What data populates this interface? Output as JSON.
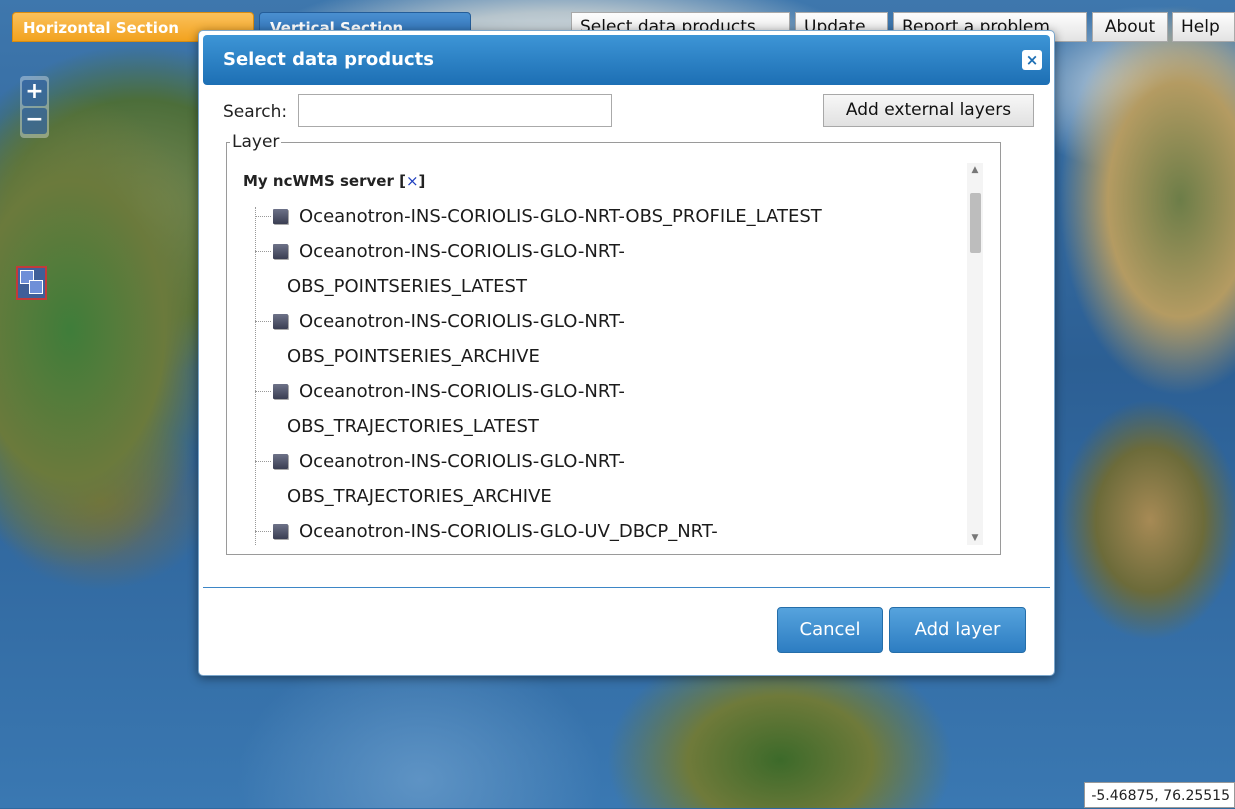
{
  "toolbar": {
    "tab_horizontal": "Horizontal Section",
    "tab_vertical": "Vertical Section",
    "select_data_products": "Select data products",
    "update": "Update",
    "report_problem": "Report a problem",
    "about": "About",
    "help": "Help"
  },
  "map": {
    "zoom_in": "+",
    "zoom_out": "−",
    "coordinates": "-5.46875, 76.25515"
  },
  "dialog": {
    "title": "Select data products",
    "close": "×",
    "search_label": "Search:",
    "search_value": "",
    "add_external_layers": "Add external layers",
    "fieldset_legend": "Layer",
    "server": {
      "name": "My ncWMS server",
      "remove_open": "[",
      "remove_x": "×",
      "remove_close": "]"
    },
    "layers": [
      {
        "line1": "Oceanotron-INS-CORIOLIS-GLO-NRT-OBS_PROFILE_LATEST",
        "line2": ""
      },
      {
        "line1": "Oceanotron-INS-CORIOLIS-GLO-NRT-",
        "line2": "OBS_POINTSERIES_LATEST"
      },
      {
        "line1": "Oceanotron-INS-CORIOLIS-GLO-NRT-",
        "line2": "OBS_POINTSERIES_ARCHIVE"
      },
      {
        "line1": "Oceanotron-INS-CORIOLIS-GLO-NRT-",
        "line2": "OBS_TRAJECTORIES_LATEST"
      },
      {
        "line1": "Oceanotron-INS-CORIOLIS-GLO-NRT-",
        "line2": "OBS_TRAJECTORIES_ARCHIVE"
      },
      {
        "line1": "Oceanotron-INS-CORIOLIS-GLO-UV_DBCP_NRT-",
        "line2": ""
      }
    ],
    "cancel": "Cancel",
    "add_layer": "Add layer"
  },
  "colors": {
    "tab_horizontal": "#f2a21e",
    "tab_vertical": "#2a6bb0",
    "dialog_header": "#1d6fb4",
    "primary_button": "#2d7dc2"
  }
}
